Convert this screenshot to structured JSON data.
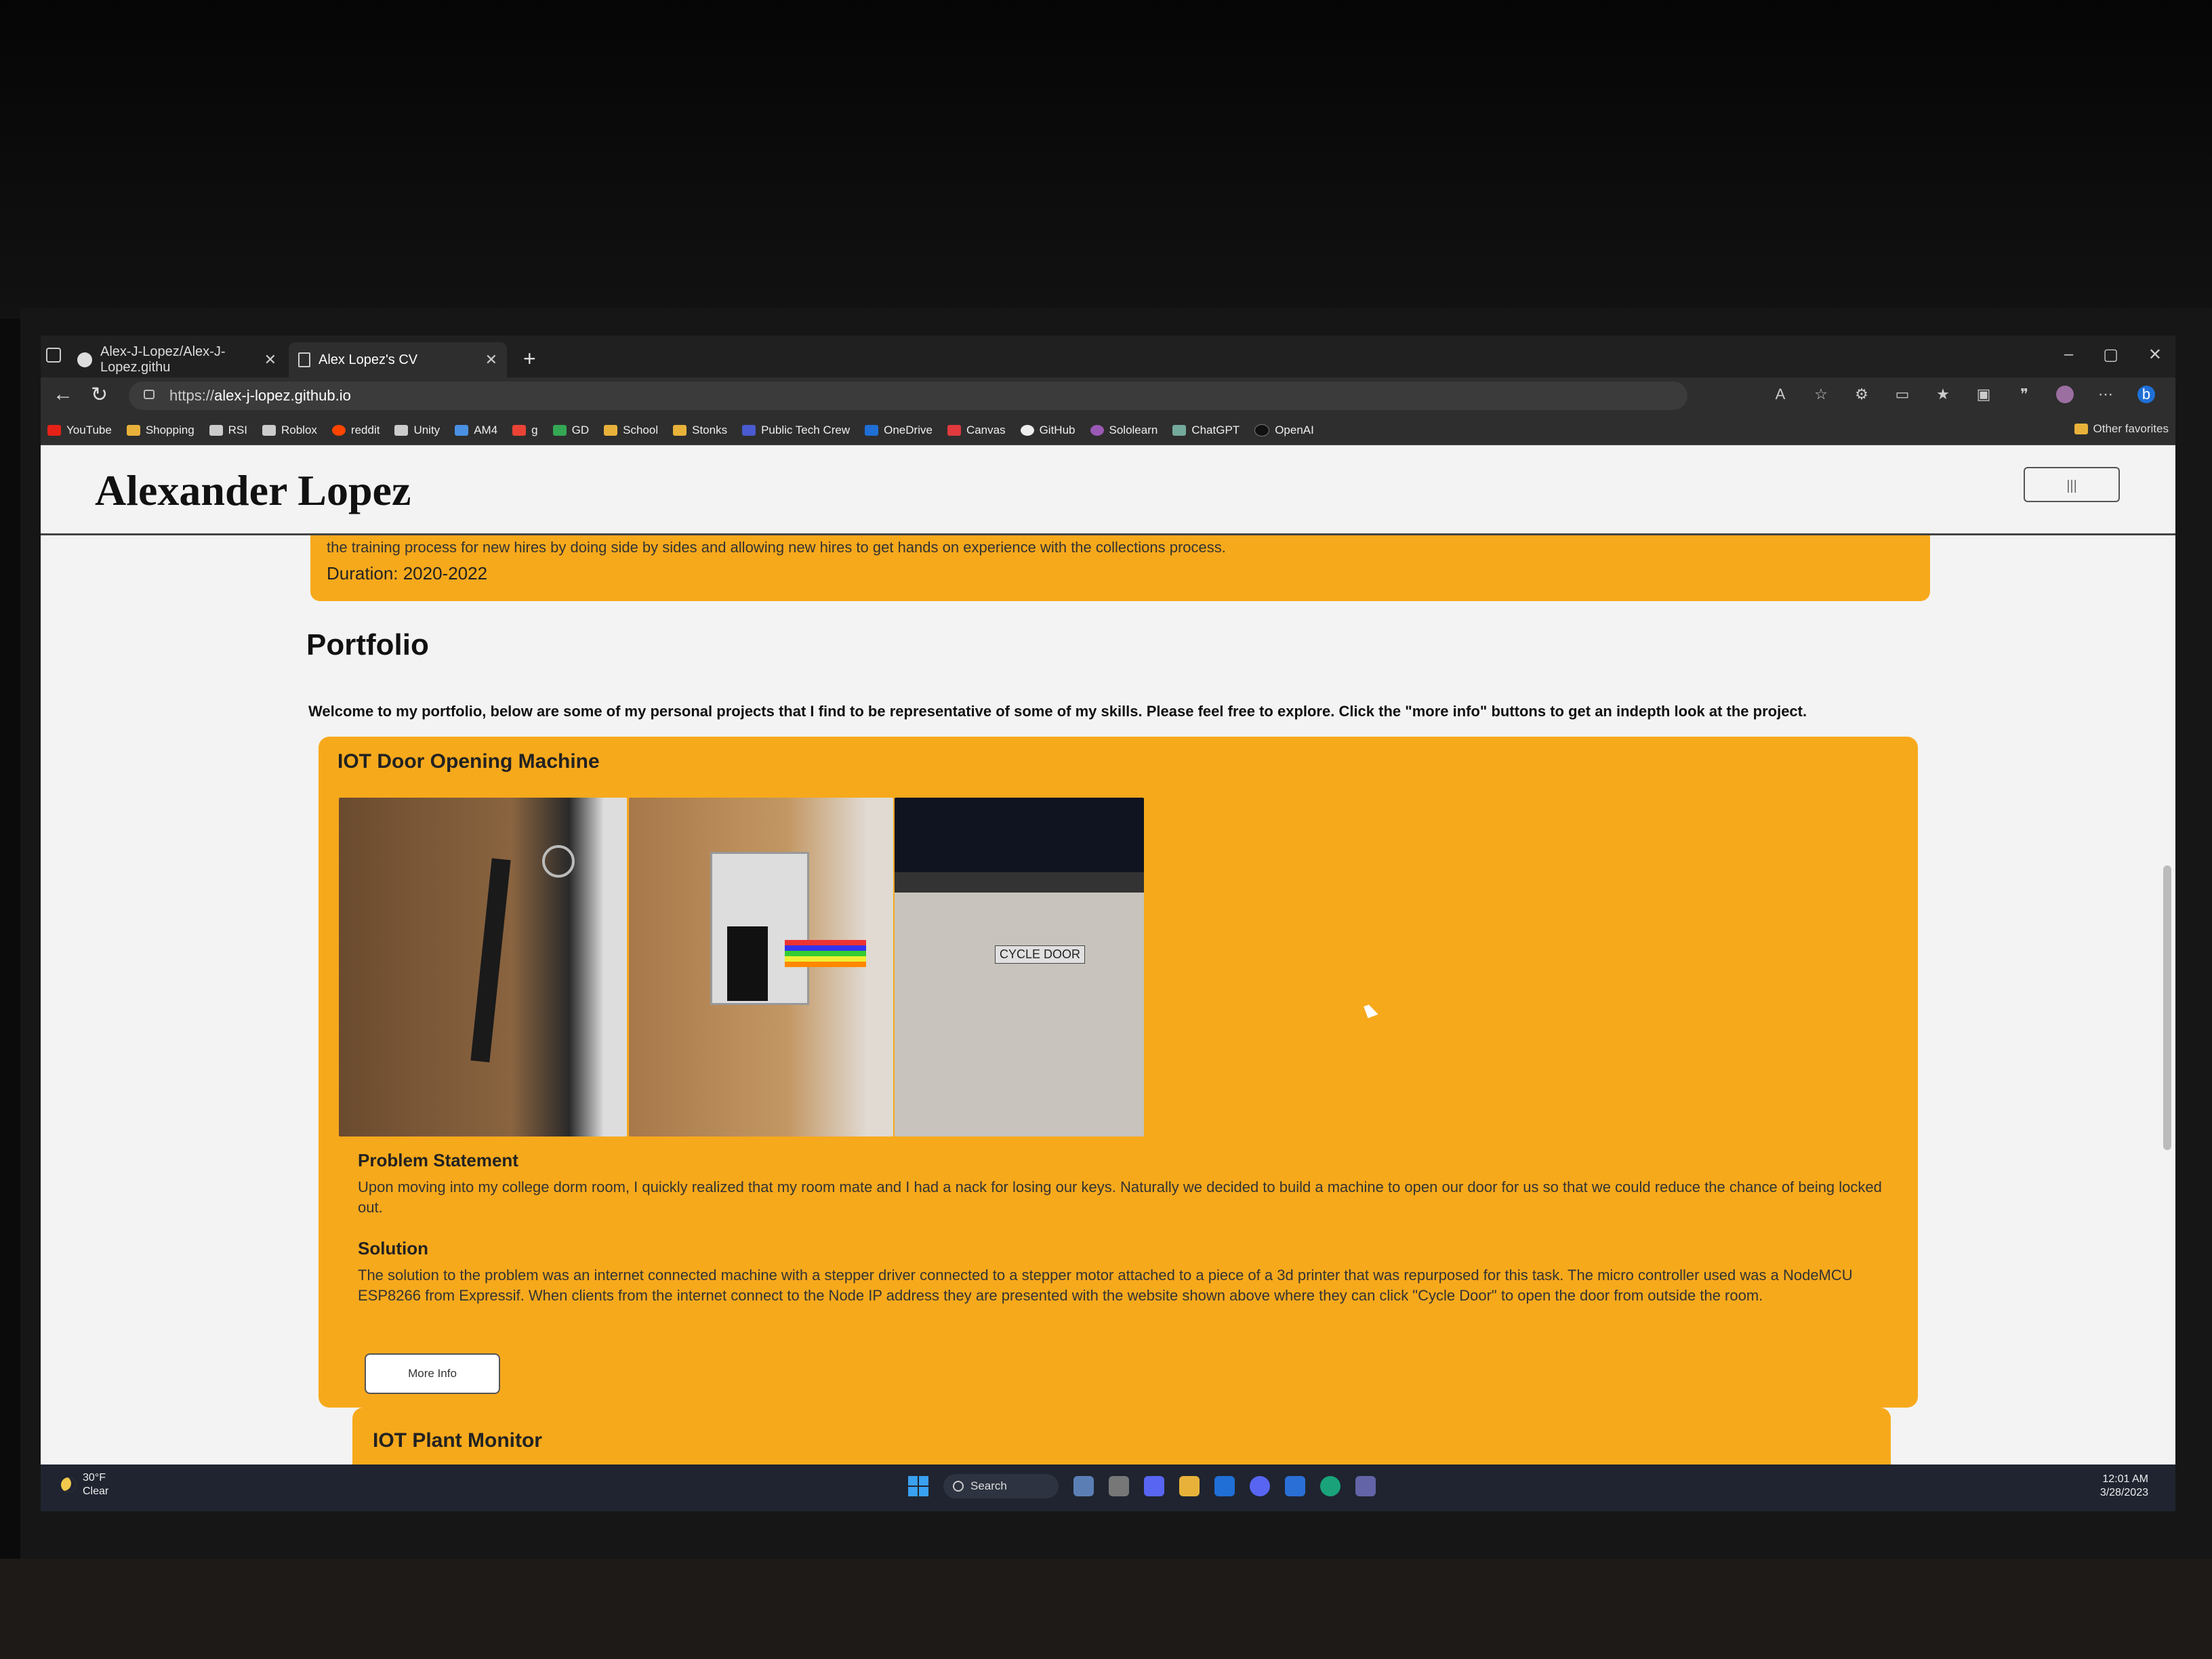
{
  "browser": {
    "tabs": [
      {
        "title": "Alex-J-Lopez/Alex-J-Lopez.githu",
        "active": false
      },
      {
        "title": "Alex Lopez's CV",
        "active": true
      }
    ],
    "new_tab": "+",
    "address_prefix": "https://",
    "address_host": "alex-j-lopez.github.io",
    "window_controls": [
      "–",
      "▢",
      "✕"
    ],
    "favorites": [
      {
        "label": "YouTube",
        "color": "#e62117"
      },
      {
        "label": "Shopping",
        "color": "#e8b23a"
      },
      {
        "label": "RSI",
        "color": "#cccccc"
      },
      {
        "label": "Roblox",
        "color": "#cccccc"
      },
      {
        "label": "reddit",
        "color": "#ff4500"
      },
      {
        "label": "Unity",
        "color": "#cccccc"
      },
      {
        "label": "AM4",
        "color": "#4a90e2"
      },
      {
        "label": "g",
        "color": "#ea4335"
      },
      {
        "label": "GD",
        "color": "#34a853"
      },
      {
        "label": "School",
        "color": "#e8b23a"
      },
      {
        "label": "Stonks",
        "color": "#e8b23a"
      },
      {
        "label": "Public Tech Crew",
        "color": "#4a5ad0"
      },
      {
        "label": "OneDrive",
        "color": "#1f6fd6"
      },
      {
        "label": "Canvas",
        "color": "#e03a3e"
      },
      {
        "label": "GitHub",
        "color": "#eeeeee"
      },
      {
        "label": "Sololearn",
        "color": "#9b59b6"
      },
      {
        "label": "ChatGPT",
        "color": "#74aa9c"
      },
      {
        "label": "OpenAI",
        "color": "#111111"
      }
    ],
    "other_favorites": "Other favorites"
  },
  "site": {
    "title": "Alexander Lopez",
    "menu_button": "|||"
  },
  "previous_card": {
    "cut_text": "the training process for new hires by doing side by sides and allowing new hires to get hands on experience with the collections process.",
    "duration": "Duration: 2020-2022"
  },
  "portfolio": {
    "heading": "Portfolio",
    "intro": "Welcome to my portfolio, below are some of my personal projects that I find to be representative of some of my skills. Please feel free to explore. Click the \"more info\" buttons to get an indepth look at the project.",
    "projects": [
      {
        "title": "IOT Door Opening Machine",
        "image_button_text": "CYCLE DOOR",
        "problem_heading": "Problem Statement",
        "problem_text": "Upon moving into my college dorm room, I quickly realized that my room mate and I had a nack for losing our keys. Naturally we decided to build a machine to open our door for us so that we could reduce the chance of being locked out.",
        "solution_heading": "Solution",
        "solution_text": "The solution to the problem was an internet connected machine with a stepper driver connected to a stepper motor attached to a piece of a 3d printer that was repurposed for this task. The micro controller used was a NodeMCU ESP8266 from Expressif. When clients from the internet connect to the Node IP address they are presented with the website shown above where they can click \"Cycle Door\" to open the door from outside the room.",
        "more_info": "More Info"
      },
      {
        "title": "IOT Plant Monitor"
      }
    ]
  },
  "taskbar": {
    "weather_temp": "30°F",
    "weather_desc": "Clear",
    "search": "Search",
    "time": "12:01 AM",
    "date": "3/28/2023"
  }
}
